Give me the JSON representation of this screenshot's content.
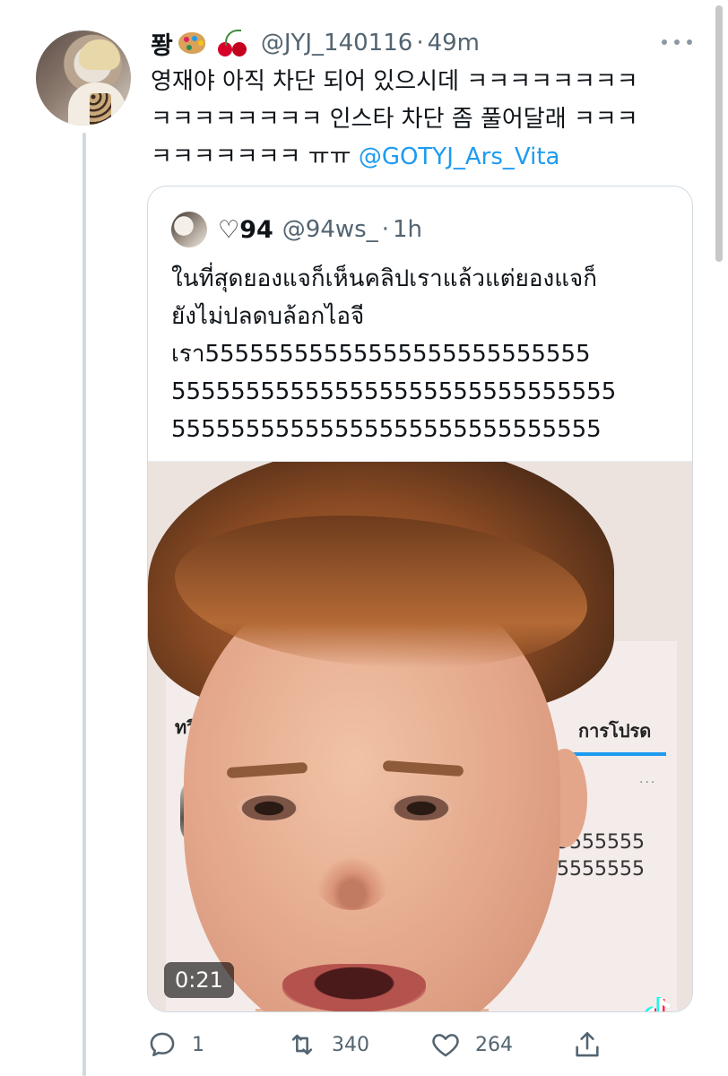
{
  "tweet": {
    "display_name": "퐝",
    "name_emojis": [
      "palette",
      "cherries"
    ],
    "handle": "@JYJ_140116",
    "separator": "·",
    "time": "49m",
    "text_lines": [
      "영재야 아직 차단 되어 있으시데 ㅋㅋㅋㅋㅋㅋㅋㅋ",
      "ㅋㅋㅋㅋㅋㅋㅋㅋ 인스타 차단 좀 풀어달래 ㅋㅋㅋ",
      "ㅋㅋㅋㅋㅋㅋㅋ ㅠㅠ"
    ],
    "mention": "@GOTYJ_Ars_Vita"
  },
  "quoted": {
    "display_name": "♡94",
    "handle": "@94ws_",
    "separator": "·",
    "time": "1h",
    "text_lines": [
      "ในที่สุดยองแจก็เห็นคลิปเราแล้วแต่ยองแจก็",
      "ยังไม่ปลดบล้อกไอจี",
      "เรา55555555555555555555555555",
      "555555555555555555555555555555",
      "55555555555555555555555555555"
    ],
    "video": {
      "duration": "0:21",
      "background_tab_left": "ทวี",
      "background_tab_right": "การโปรด",
      "background_digits": [
        "55555555555",
        "55555555555"
      ]
    }
  },
  "actions": {
    "reply_count": "1",
    "retweet_count": "340",
    "like_count": "264"
  },
  "colors": {
    "accent": "#1d9bf0",
    "secondary_text": "#536471",
    "border": "#cfd9de"
  }
}
